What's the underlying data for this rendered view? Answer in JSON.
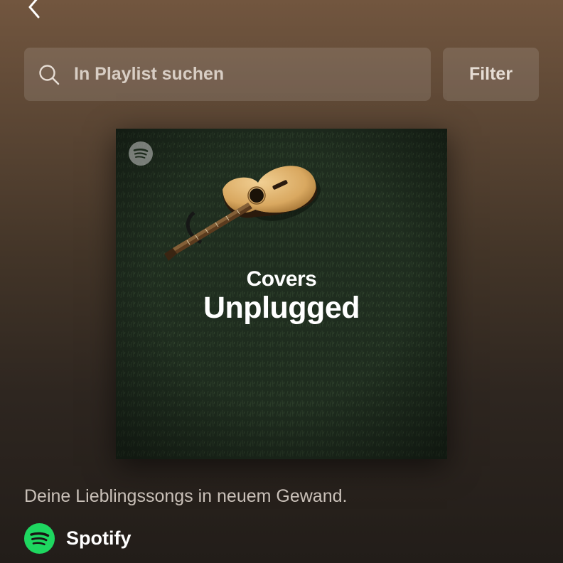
{
  "search": {
    "placeholder": "In Playlist suchen",
    "icon": "search-icon"
  },
  "filter": {
    "label": "Filter"
  },
  "nav": {
    "back_icon": "chevron-left-icon"
  },
  "playlist": {
    "cover_line1": "Covers",
    "cover_line2": "Unplugged",
    "description": "Deine Lieblingssongs in neuem Gewand.",
    "owner": "Spotify"
  },
  "colors": {
    "spotify_green": "#1ed760",
    "header_gradient_top": "#72563f",
    "background_bottom": "#221d19"
  }
}
